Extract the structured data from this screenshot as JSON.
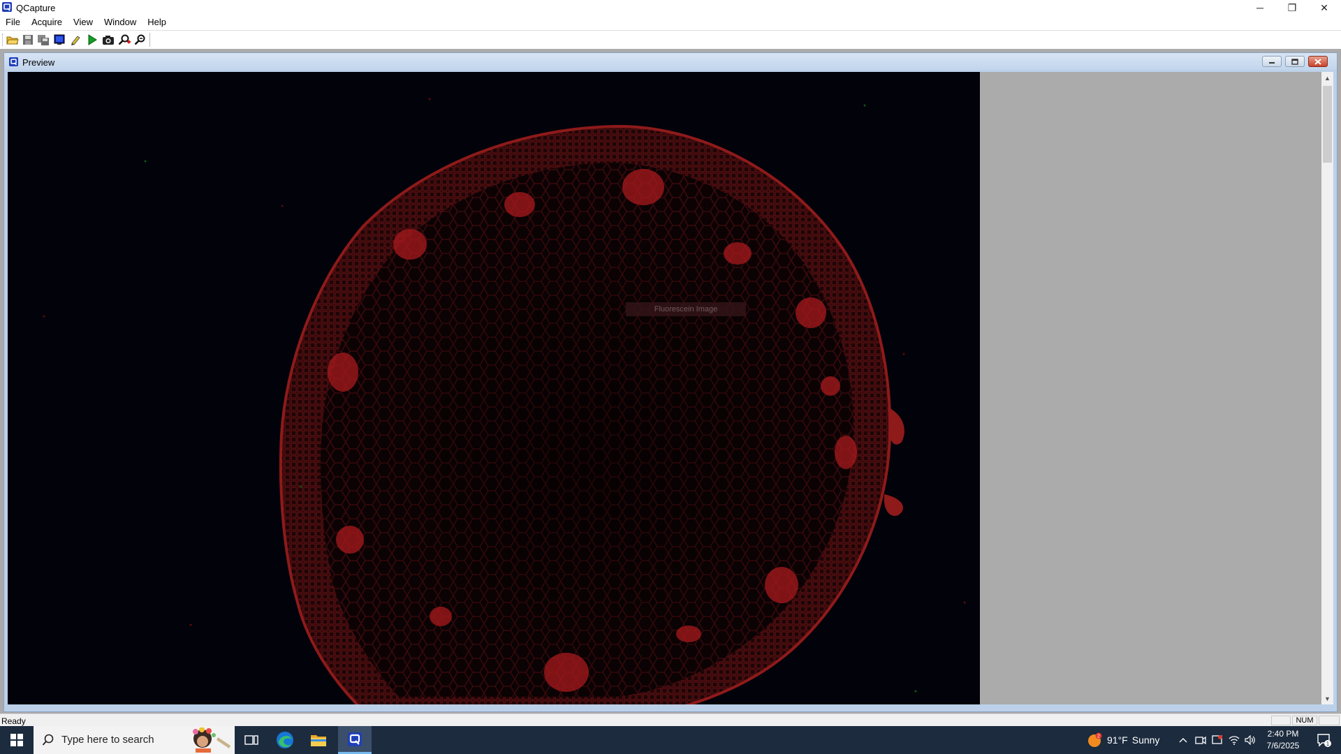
{
  "window": {
    "title": "QCapture",
    "minimize_symbol": "─",
    "restore_symbol": "❐",
    "close_symbol": "✕"
  },
  "menu": [
    "File",
    "Acquire",
    "View",
    "Window",
    "Help"
  ],
  "toolbar": {
    "buttons": [
      "open-folder-icon",
      "save-icon",
      "save-all-icon",
      "monitor-icon",
      "pencil-icon",
      "play-icon",
      "camera-icon",
      "zoom-in-icon",
      "zoom-out-icon"
    ]
  },
  "preview_window": {
    "title": "Preview",
    "overlay_text": "Fluorescein Image"
  },
  "status": {
    "text": "Ready",
    "num": "NUM"
  },
  "taskbar": {
    "search_placeholder": "Type here to search",
    "weather_temp": "91°F",
    "weather_desc": "Sunny",
    "weather_badge": "2",
    "time": "2:40 PM",
    "date": "7/6/2025",
    "notification_count": "1"
  },
  "colors": {
    "accent": "#76b9ed",
    "taskbar": "#1c2b3e",
    "image_background": "#02020a",
    "specimen_red": "#b01818"
  }
}
